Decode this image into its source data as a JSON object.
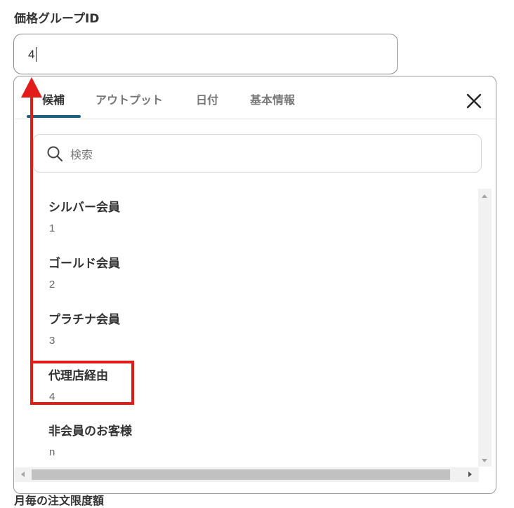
{
  "field": {
    "label": "価格グループID",
    "value": "4"
  },
  "dropdown": {
    "tabs": [
      {
        "label": "候補"
      },
      {
        "label": "アウトプット"
      },
      {
        "label": "日付"
      },
      {
        "label": "基本情報"
      }
    ],
    "search": {
      "placeholder": "検索"
    },
    "options": [
      {
        "label": "シルバー会員",
        "value": "1"
      },
      {
        "label": "ゴールド会員",
        "value": "2"
      },
      {
        "label": "プラチナ会員",
        "value": "3"
      },
      {
        "label": "代理店経由",
        "value": "4"
      },
      {
        "label": "非会員のお客様",
        "value": "n"
      }
    ]
  },
  "next_field": {
    "label": "月毎の注文限度額"
  },
  "annotation_color": "#e21b1b",
  "accent_color": "#1f5f7e",
  "icons": [
    "close-icon",
    "search-icon"
  ]
}
